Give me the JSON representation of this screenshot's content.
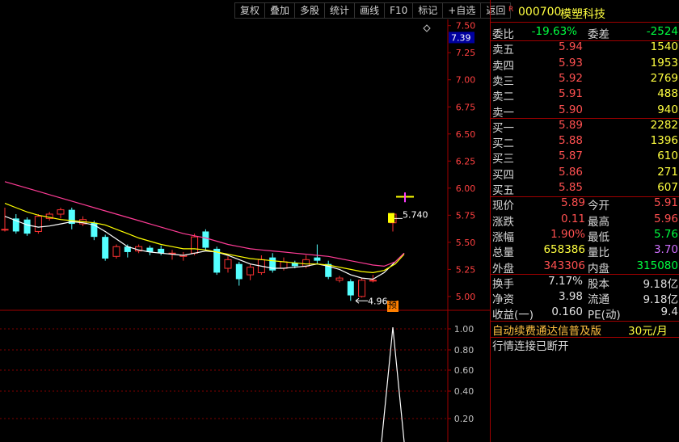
{
  "toolbar": [
    "复权",
    "叠加",
    "多股",
    "统计",
    "画线",
    "F10",
    "标记",
    "+自选",
    "返回"
  ],
  "stock": {
    "badge": "R",
    "code": "000700",
    "name": "模塑科技"
  },
  "ratio": {
    "label1": "委比",
    "value1": "-19.63%",
    "label2": "委差",
    "value2": "-2524"
  },
  "asks": [
    {
      "label": "卖五",
      "price": "5.94",
      "vol": "1540"
    },
    {
      "label": "卖四",
      "price": "5.93",
      "vol": "1953"
    },
    {
      "label": "卖三",
      "price": "5.92",
      "vol": "2769"
    },
    {
      "label": "卖二",
      "price": "5.91",
      "vol": "488"
    },
    {
      "label": "卖一",
      "price": "5.90",
      "vol": "940"
    }
  ],
  "bids": [
    {
      "label": "买一",
      "price": "5.89",
      "vol": "2282"
    },
    {
      "label": "买二",
      "price": "5.88",
      "vol": "1396"
    },
    {
      "label": "买三",
      "price": "5.87",
      "vol": "610"
    },
    {
      "label": "买四",
      "price": "5.86",
      "vol": "271"
    },
    {
      "label": "买五",
      "price": "5.85",
      "vol": "607"
    }
  ],
  "quote": [
    {
      "l1": "现价",
      "v1": "5.89",
      "l2": "今开",
      "v2": "5.91",
      "c1": "red",
      "c2": "red"
    },
    {
      "l1": "涨跌",
      "v1": "0.11",
      "l2": "最高",
      "v2": "5.96",
      "c1": "red",
      "c2": "red"
    },
    {
      "l1": "涨幅",
      "v1": "1.90%",
      "l2": "最低",
      "v2": "5.76",
      "c1": "red",
      "c2": "green"
    },
    {
      "l1": "总量",
      "v1": "658386",
      "l2": "量比",
      "v2": "3.70",
      "c1": "yellow",
      "c2": "purple"
    },
    {
      "l1": "外盘",
      "v1": "343306",
      "l2": "内盘",
      "v2": "315080",
      "c1": "red",
      "c2": "green"
    }
  ],
  "fundamentals": [
    {
      "l1": "换手",
      "v1": "7.17%",
      "l2": "股本",
      "v2": "9.18亿"
    },
    {
      "l1": "净资",
      "v1": "3.98",
      "l2": "流通",
      "v2": "9.18亿"
    },
    {
      "l1": "收益(一)",
      "v1": "0.160",
      "l2": "PE(动)",
      "v2": "9.4"
    }
  ],
  "promo": {
    "text": "自动续费通达信普及版",
    "price": "30元/月"
  },
  "status": "行情连接已断开",
  "colors": {
    "up": "#ff3232",
    "down": "#54ffff",
    "ma1": "#ffffff",
    "ma2": "#ffff00",
    "ma3": "#ff3c96",
    "grid": "#800000"
  },
  "chart_data": {
    "type": "candlestick",
    "price_axis": {
      "min": 4.88,
      "max": 7.52,
      "ticks": [
        "7.50",
        "7.25",
        "7.00",
        "6.75",
        "6.50",
        "6.25",
        "6.00",
        "5.75",
        "5.50",
        "5.25",
        "5.00"
      ]
    },
    "current_price_label": "7.39",
    "annotations": {
      "high_label": "5.740",
      "low_label": "4.96",
      "pre_badge": "预"
    },
    "candles": [
      {
        "o": 5.62,
        "c": 5.62,
        "h": 5.82,
        "l": 5.6
      },
      {
        "o": 5.72,
        "c": 5.6,
        "h": 5.76,
        "l": 5.58
      },
      {
        "o": 5.71,
        "c": 5.58,
        "h": 5.73,
        "l": 5.56
      },
      {
        "o": 5.6,
        "c": 5.74,
        "h": 5.76,
        "l": 5.58
      },
      {
        "o": 5.72,
        "c": 5.76,
        "h": 5.78,
        "l": 5.7
      },
      {
        "o": 5.76,
        "c": 5.8,
        "h": 5.82,
        "l": 5.72
      },
      {
        "o": 5.8,
        "c": 5.67,
        "h": 5.82,
        "l": 5.62
      },
      {
        "o": 5.67,
        "c": 5.71,
        "h": 5.74,
        "l": 5.65
      },
      {
        "o": 5.68,
        "c": 5.55,
        "h": 5.7,
        "l": 5.52
      },
      {
        "o": 5.55,
        "c": 5.35,
        "h": 5.57,
        "l": 5.33
      },
      {
        "o": 5.37,
        "c": 5.46,
        "h": 5.48,
        "l": 5.35
      },
      {
        "o": 5.46,
        "c": 5.41,
        "h": 5.48,
        "l": 5.36
      },
      {
        "o": 5.42,
        "c": 5.46,
        "h": 5.48,
        "l": 5.4
      },
      {
        "o": 5.45,
        "c": 5.41,
        "h": 5.47,
        "l": 5.38
      },
      {
        "o": 5.44,
        "c": 5.4,
        "h": 5.47,
        "l": 5.38
      },
      {
        "o": 5.4,
        "c": 5.4,
        "h": 5.43,
        "l": 5.34
      },
      {
        "o": 5.37,
        "c": 5.38,
        "h": 5.41,
        "l": 5.33
      },
      {
        "o": 5.4,
        "c": 5.55,
        "h": 5.58,
        "l": 5.38
      },
      {
        "o": 5.6,
        "c": 5.45,
        "h": 5.62,
        "l": 5.43
      },
      {
        "o": 5.44,
        "c": 5.22,
        "h": 5.46,
        "l": 5.2
      },
      {
        "o": 5.26,
        "c": 5.34,
        "h": 5.37,
        "l": 5.22
      },
      {
        "o": 5.3,
        "c": 5.16,
        "h": 5.32,
        "l": 5.1
      },
      {
        "o": 5.2,
        "c": 5.27,
        "h": 5.3,
        "l": 5.15
      },
      {
        "o": 5.22,
        "c": 5.34,
        "h": 5.38,
        "l": 5.2
      },
      {
        "o": 5.36,
        "c": 5.24,
        "h": 5.4,
        "l": 5.22
      },
      {
        "o": 5.26,
        "c": 5.32,
        "h": 5.36,
        "l": 5.24
      },
      {
        "o": 5.31,
        "c": 5.28,
        "h": 5.33,
        "l": 5.26
      },
      {
        "o": 5.28,
        "c": 5.34,
        "h": 5.38,
        "l": 5.26
      },
      {
        "o": 5.36,
        "c": 5.33,
        "h": 5.48,
        "l": 5.3
      },
      {
        "o": 5.3,
        "c": 5.18,
        "h": 5.33,
        "l": 5.16
      },
      {
        "o": 5.15,
        "c": 5.17,
        "h": 5.19,
        "l": 5.13
      },
      {
        "o": 5.14,
        "c": 5.01,
        "h": 5.16,
        "l": 4.96
      },
      {
        "o": 5.0,
        "c": 5.15,
        "h": 5.17,
        "l": 4.99
      },
      {
        "o": 5.15,
        "c": 5.15,
        "h": 5.2,
        "l": 5.13
      },
      {
        "o": 5.68,
        "c": 5.76,
        "h": 5.77,
        "l": 5.6
      }
    ],
    "ma_lines": [
      {
        "name": "MA5",
        "color": "#ffffff",
        "values": [
          5.74,
          5.7,
          5.66,
          5.64,
          5.65,
          5.67,
          5.69,
          5.68,
          5.66,
          5.6,
          5.53,
          5.46,
          5.43,
          5.41,
          5.4,
          5.39,
          5.38,
          5.4,
          5.42,
          5.41,
          5.38,
          5.34,
          5.3,
          5.28,
          5.26,
          5.26,
          5.27,
          5.28,
          5.3,
          5.28,
          5.25,
          5.2,
          5.17,
          5.16,
          5.22,
          5.32,
          5.4
        ]
      },
      {
        "name": "MA10",
        "color": "#ffff00",
        "values": [
          5.86,
          5.82,
          5.78,
          5.75,
          5.73,
          5.71,
          5.7,
          5.69,
          5.68,
          5.66,
          5.62,
          5.58,
          5.54,
          5.51,
          5.48,
          5.46,
          5.44,
          5.44,
          5.43,
          5.41,
          5.39,
          5.37,
          5.35,
          5.34,
          5.33,
          5.32,
          5.31,
          5.3,
          5.3,
          5.29,
          5.27,
          5.25,
          5.23,
          5.22,
          5.24,
          5.3,
          5.39
        ]
      },
      {
        "name": "MA20",
        "color": "#ff3c96",
        "values": [
          6.06,
          6.03,
          6.0,
          5.97,
          5.94,
          5.91,
          5.88,
          5.85,
          5.82,
          5.79,
          5.76,
          5.73,
          5.7,
          5.67,
          5.64,
          5.61,
          5.58,
          5.56,
          5.54,
          5.51,
          5.48,
          5.46,
          5.44,
          5.43,
          5.42,
          5.41,
          5.4,
          5.39,
          5.38,
          5.37,
          5.35,
          5.33,
          5.31,
          5.29,
          5.28,
          5.32,
          5.4
        ]
      }
    ],
    "indicator": {
      "axis_ticks": [
        "1.00",
        "0.80",
        "0.60",
        "0.40",
        "0.20"
      ],
      "min": 0.0,
      "max": 1.0,
      "values": [
        0,
        0,
        0,
        0,
        0,
        0,
        0,
        0,
        0,
        0,
        0,
        0,
        0,
        0,
        0,
        0,
        0,
        0,
        0,
        0,
        0,
        0,
        0,
        0,
        0,
        0,
        0,
        0,
        0,
        0,
        0,
        0,
        0,
        0,
        1,
        0
      ]
    }
  }
}
